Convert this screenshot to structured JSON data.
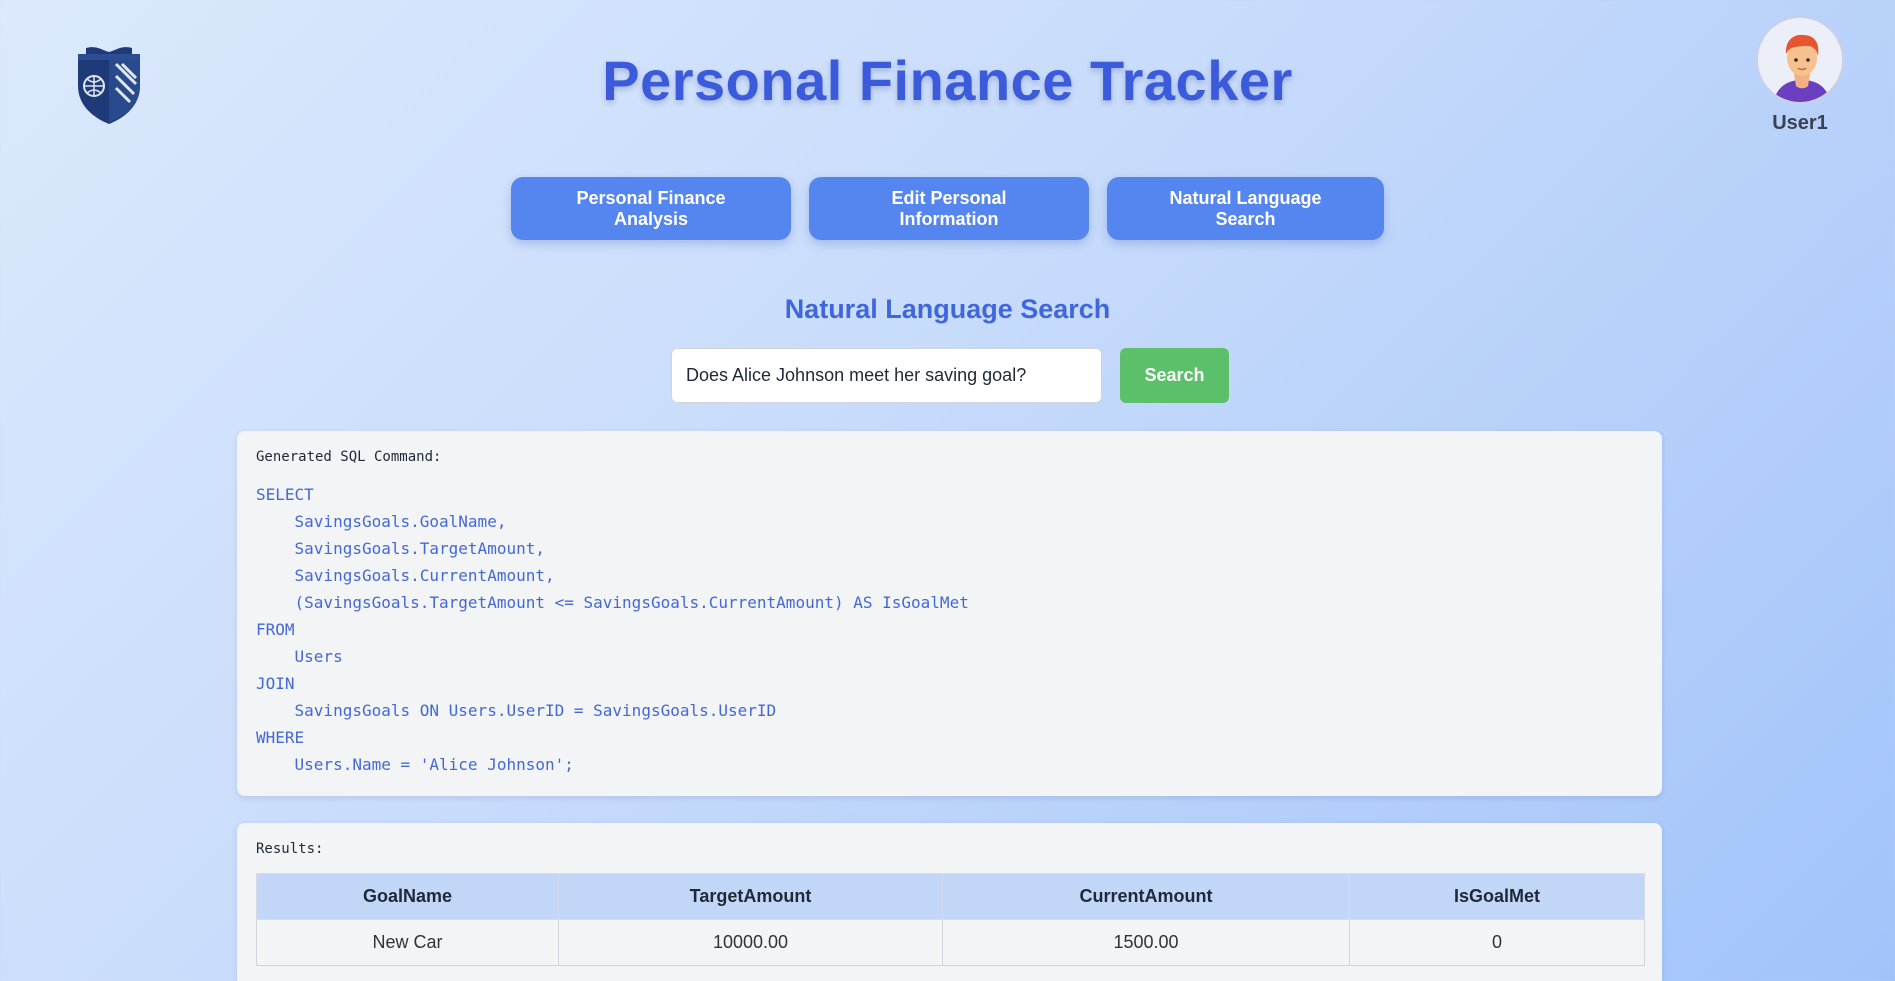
{
  "app": {
    "title": "Personal Finance Tracker"
  },
  "user": {
    "name": "User1"
  },
  "nav": {
    "items": [
      {
        "label": "Personal Finance Analysis"
      },
      {
        "label": "Edit Personal Information"
      },
      {
        "label": "Natural Language Search"
      }
    ]
  },
  "search": {
    "heading": "Natural Language Search",
    "query": "Does Alice Johnson meet her saving goal?",
    "button_label": "Search"
  },
  "sql": {
    "label": "Generated SQL Command:",
    "code": "SELECT\n    SavingsGoals.GoalName,\n    SavingsGoals.TargetAmount,\n    SavingsGoals.CurrentAmount,\n    (SavingsGoals.TargetAmount <= SavingsGoals.CurrentAmount) AS IsGoalMet\nFROM\n    Users\nJOIN\n    SavingsGoals ON Users.UserID = SavingsGoals.UserID\nWHERE\n    Users.Name = 'Alice Johnson';"
  },
  "results": {
    "label": "Results:",
    "columns": [
      "GoalName",
      "TargetAmount",
      "CurrentAmount",
      "IsGoalMet"
    ],
    "rows": [
      [
        "New Car",
        "10000.00",
        "1500.00",
        "0"
      ]
    ]
  },
  "colors": {
    "title": "#3b5bdb",
    "nav_button": "#5585ee",
    "search_button": "#5cc06a",
    "sql_text": "#4468d6",
    "table_header": "#c2d6f8"
  }
}
